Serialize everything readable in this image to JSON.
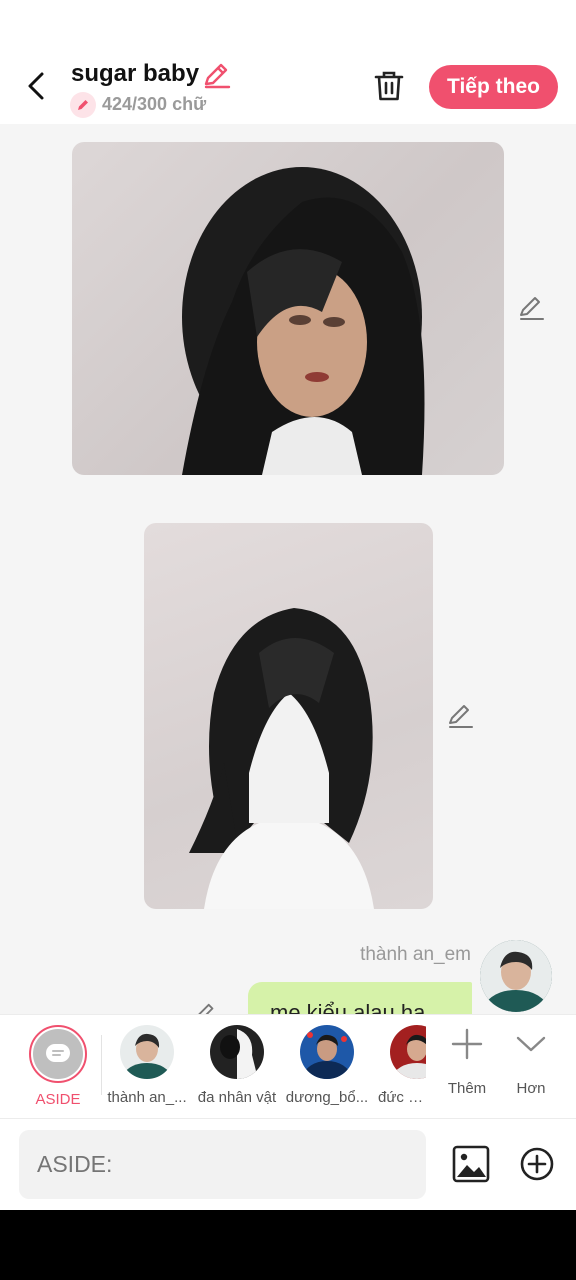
{
  "header": {
    "title": "sugar baby",
    "word_count": "424/300 chữ",
    "next_label": "Tiếp theo",
    "accent_color": "#f0506e"
  },
  "messages": {
    "user_name": "thành an_em",
    "bubble_text": "mẹ kiểu alau hạ"
  },
  "characters": [
    {
      "label": "ASIDE"
    },
    {
      "label": "thành an_..."
    },
    {
      "label": "đa nhân vật"
    },
    {
      "label": "dương_bổ..."
    },
    {
      "label": "đức d..."
    }
  ],
  "char_actions": {
    "add_label": "Thêm",
    "more_label": "Hơn"
  },
  "input": {
    "placeholder": "ASIDE:"
  },
  "icons": [
    "back-arrow-icon",
    "pencil-icon",
    "trash-icon",
    "image-icon",
    "plus-circle-icon",
    "plus-icon",
    "chevron-down-icon",
    "message-icon"
  ]
}
